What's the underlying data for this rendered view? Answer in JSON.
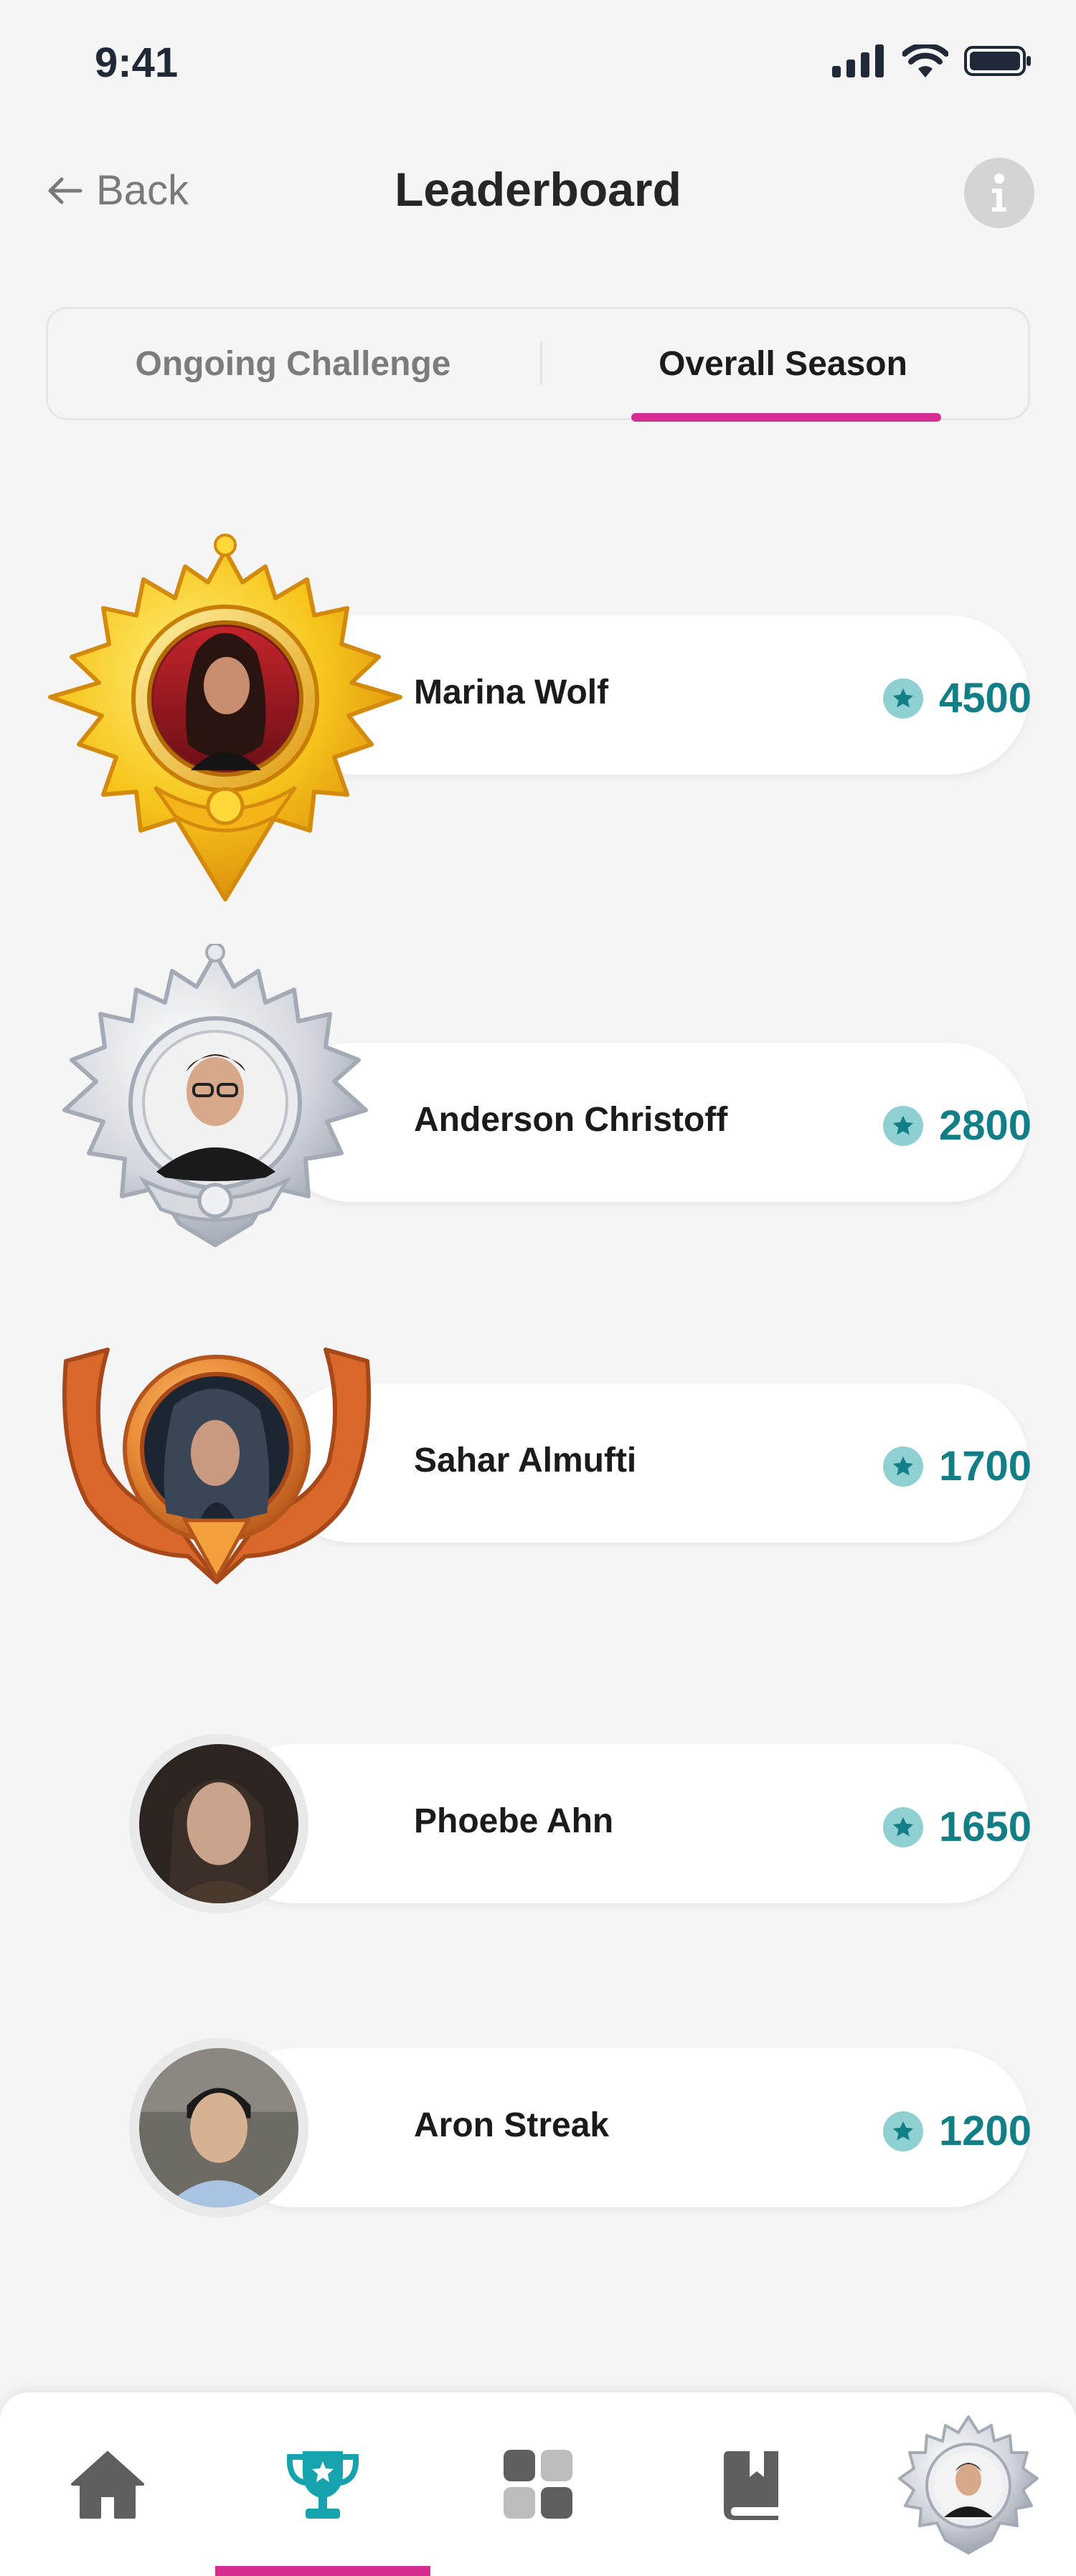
{
  "status_bar": {
    "time": "9:41"
  },
  "header": {
    "back_label": "Back",
    "title": "Leaderboard"
  },
  "tabs": [
    {
      "label": "Ongoing Challenge",
      "active": false
    },
    {
      "label": "Overall Season",
      "active": true
    }
  ],
  "leaderboard": [
    {
      "name": "Marina Wolf",
      "score": "4500",
      "medal": "gold"
    },
    {
      "name": "Anderson Christoff",
      "score": "2800",
      "medal": "silver"
    },
    {
      "name": "Sahar Almufti",
      "score": "1700",
      "medal": "bronze"
    },
    {
      "name": "Phoebe Ahn",
      "score": "1650",
      "medal": "none"
    },
    {
      "name": "Aron Streak",
      "score": "1200",
      "medal": "none"
    }
  ],
  "bottom_nav": [
    {
      "icon": "home-icon",
      "active": false
    },
    {
      "icon": "trophy-icon",
      "active": true
    },
    {
      "icon": "grid-icon",
      "active": false
    },
    {
      "icon": "book-icon",
      "active": false
    },
    {
      "icon": "profile-avatar",
      "active": false
    }
  ],
  "colors": {
    "accent": "#d62d92",
    "score": "#127f86",
    "score_icon": "#8fd1d2",
    "nav_active": "#16a3ad",
    "nav_inactive": "#5f5f5f"
  }
}
